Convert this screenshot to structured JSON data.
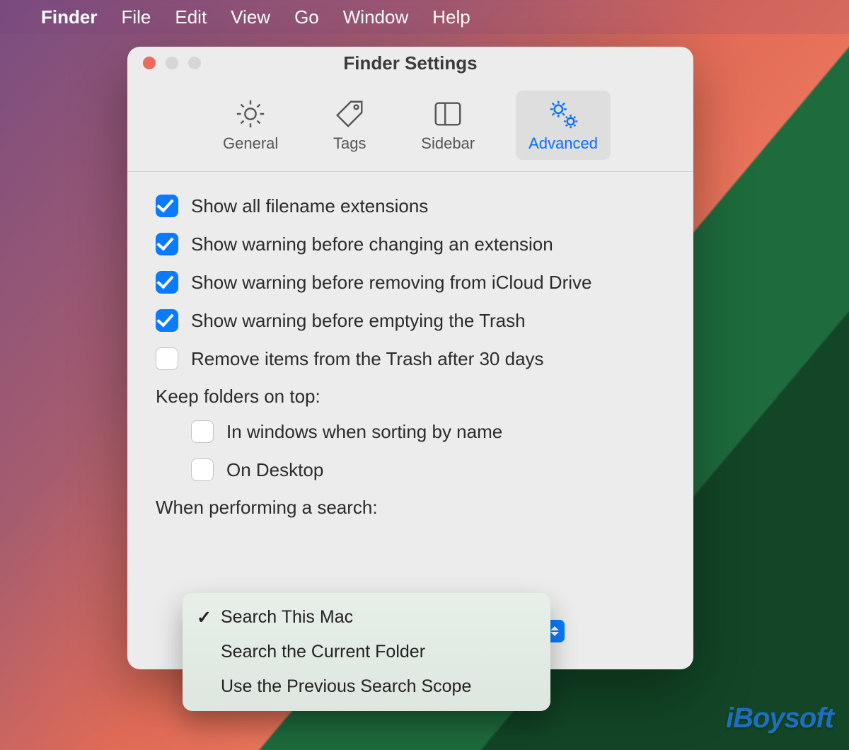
{
  "menubar": {
    "app": "Finder",
    "items": [
      "File",
      "Edit",
      "View",
      "Go",
      "Window",
      "Help"
    ]
  },
  "window": {
    "title": "Finder Settings",
    "tabs": [
      {
        "id": "general",
        "label": "General"
      },
      {
        "id": "tags",
        "label": "Tags"
      },
      {
        "id": "sidebar",
        "label": "Sidebar"
      },
      {
        "id": "advanced",
        "label": "Advanced",
        "active": true
      }
    ]
  },
  "advanced": {
    "checks": [
      {
        "label": "Show all filename extensions",
        "checked": true
      },
      {
        "label": "Show warning before changing an extension",
        "checked": true
      },
      {
        "label": "Show warning before removing from iCloud Drive",
        "checked": true
      },
      {
        "label": "Show warning before emptying the Trash",
        "checked": true
      },
      {
        "label": "Remove items from the Trash after 30 days",
        "checked": false
      }
    ],
    "keep_on_top_label": "Keep folders on top:",
    "keep_on_top": [
      {
        "label": "In windows when sorting by name",
        "checked": false
      },
      {
        "label": "On Desktop",
        "checked": false
      }
    ],
    "search_label": "When performing a search:",
    "search_options": [
      {
        "label": "Search This Mac",
        "selected": true
      },
      {
        "label": "Search the Current Folder",
        "selected": false
      },
      {
        "label": "Use the Previous Search Scope",
        "selected": false
      }
    ]
  },
  "watermark": "iBoysoft"
}
